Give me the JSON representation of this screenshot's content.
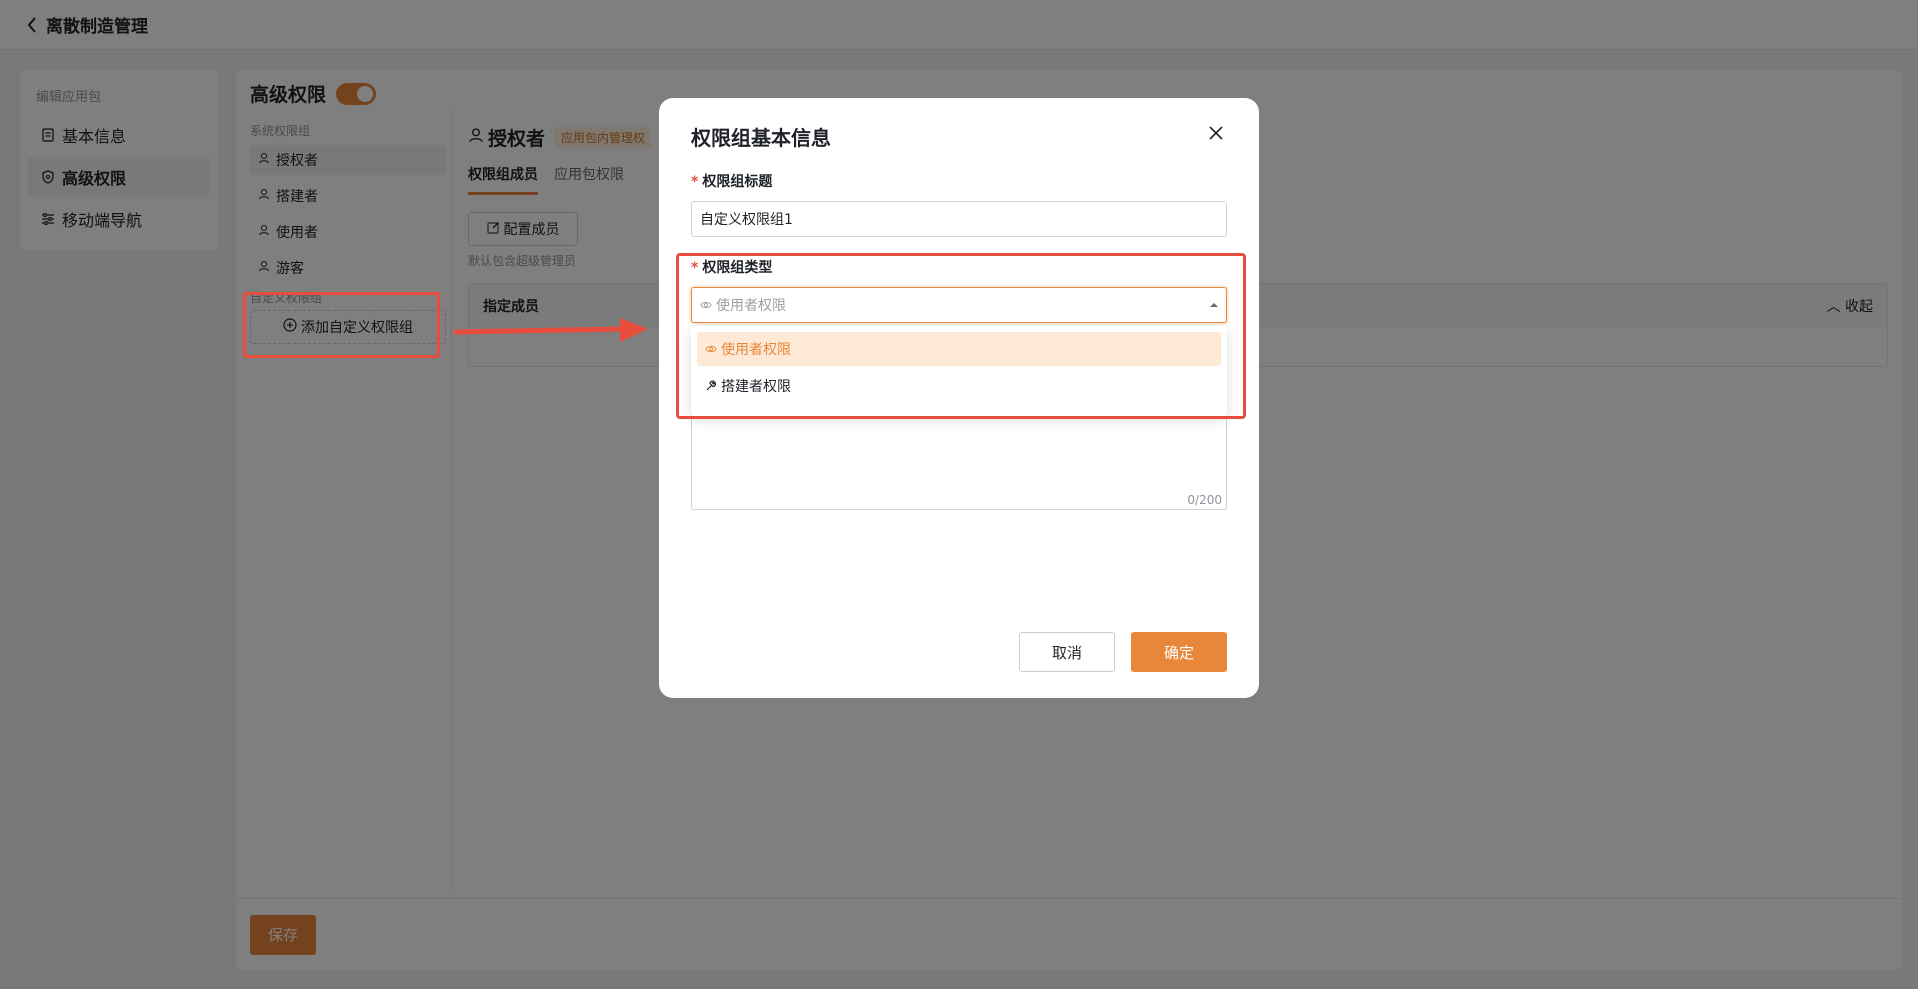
{
  "topbar": {
    "title": "离散制造管理"
  },
  "leftnav": {
    "group": "编辑应用包",
    "items": [
      {
        "label": "基本信息",
        "icon": "document-icon"
      },
      {
        "label": "高级权限",
        "icon": "shield-icon"
      },
      {
        "label": "移动端导航",
        "icon": "sliders-icon"
      }
    ]
  },
  "advanced": {
    "title": "高级权限",
    "system_group_label": "系统权限组",
    "system_items": [
      "授权者",
      "搭建者",
      "使用者",
      "游客"
    ],
    "custom_group_label": "自定义权限组",
    "add_custom_label": "添加自定义权限组"
  },
  "content": {
    "title": "授权者",
    "badge": "应用包内管理权",
    "tabs": [
      "权限组成员",
      "应用包权限"
    ],
    "config_button": "配置成员",
    "hint": "默认包含超级管理员",
    "table_header": "指定成员",
    "collapse_label": "收起"
  },
  "footer": {
    "save_label": "保存"
  },
  "modal": {
    "title": "权限组基本信息",
    "name_label": "权限组标题",
    "name_value": "自定义权限组1",
    "type_label": "权限组类型",
    "type_placeholder": "使用者权限",
    "options": [
      "使用者权限",
      "搭建者权限"
    ],
    "desc_count": "0/200",
    "cancel_label": "取消",
    "ok_label": "确定"
  },
  "colors": {
    "accent": "#e8873a",
    "annotation": "#e74c3c"
  }
}
